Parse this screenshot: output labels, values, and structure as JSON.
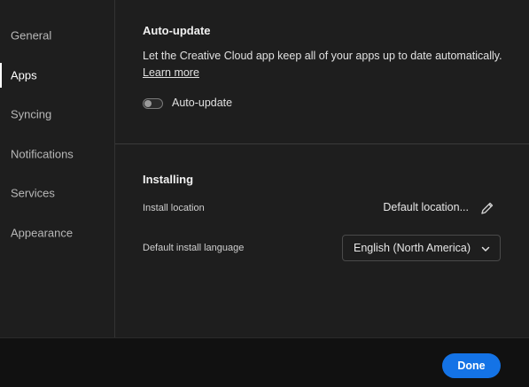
{
  "sidebar": {
    "items": [
      {
        "label": "General",
        "active": false
      },
      {
        "label": "Apps",
        "active": true
      },
      {
        "label": "Syncing",
        "active": false
      },
      {
        "label": "Notifications",
        "active": false
      },
      {
        "label": "Services",
        "active": false
      },
      {
        "label": "Appearance",
        "active": false
      }
    ]
  },
  "auto_update": {
    "title": "Auto-update",
    "description": "Let the Creative Cloud app keep all of your apps up to date automatically.",
    "learn_more": "Learn more",
    "toggle_label": "Auto-update",
    "toggle_on": false
  },
  "installing": {
    "title": "Installing",
    "install_location_label": "Install location",
    "install_location_value": "Default location...",
    "language_label": "Default install language",
    "language_value": "English (North America)"
  },
  "footer": {
    "done_label": "Done"
  },
  "colors": {
    "accent": "#1473e6",
    "background": "#1e1e1e",
    "footer": "#111111"
  },
  "icons": {
    "edit": "pencil-icon",
    "dropdown": "chevron-down-icon"
  }
}
